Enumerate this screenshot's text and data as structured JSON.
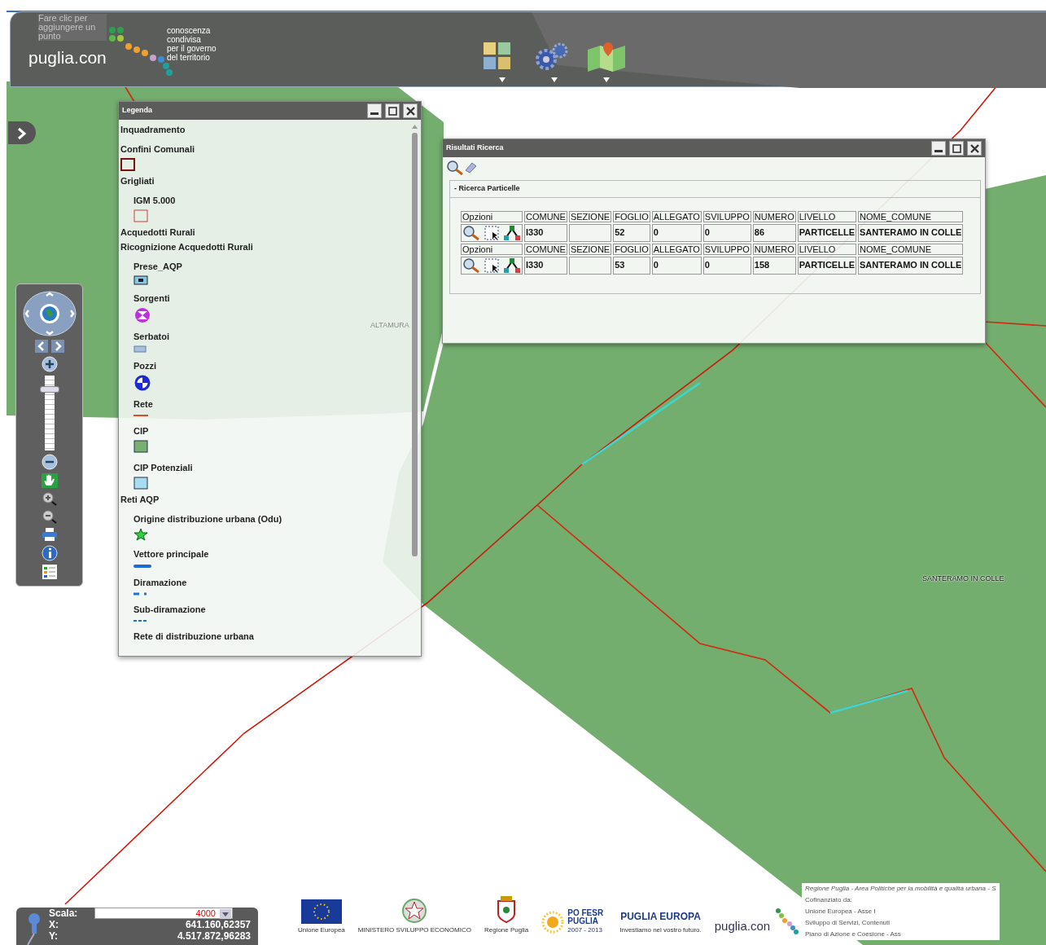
{
  "header": {
    "hint": "Fare clic per aggiungere un punto",
    "logo": "puglia.con",
    "tagline": "conoscenza\ncondivisa\nper il governo\ndel territorio",
    "tools": [
      {
        "kind": "layers"
      },
      {
        "kind": "settings"
      },
      {
        "kind": "map"
      }
    ]
  },
  "map": {
    "labels": [
      {
        "kind": "faint",
        "text": "ALTAMURA"
      },
      {
        "kind": "dark",
        "text": "SANTERAMO IN COLLE"
      }
    ]
  },
  "legend": {
    "title": "Legenda",
    "entries": [
      {
        "label": "Inquadramento"
      },
      {
        "label": "Confini Comunali",
        "kind": "outline-dark"
      },
      {
        "label": "Grigliati",
        "children": [
          {
            "label": "IGM 5.000",
            "kind": "outline-red"
          }
        ]
      },
      {
        "label": "Acquedotti Rurali"
      },
      {
        "label": "Ricognizione Acquedotti Rurali",
        "children": [
          {
            "label": "Prese_AQP",
            "kind": "tap"
          },
          {
            "label": "Sorgenti",
            "kind": "source"
          },
          {
            "label": "Serbatoi",
            "kind": "tank"
          },
          {
            "label": "Pozzi",
            "kind": "well"
          },
          {
            "label": "Rete",
            "kind": "line-red"
          },
          {
            "label": "CIP",
            "kind": "fill-green"
          },
          {
            "label": "CIP Potenziali",
            "kind": "fill-blue"
          }
        ]
      },
      {
        "label": "Reti AQP",
        "children": [
          {
            "label": "Origine distribuzione urbana (Odu)",
            "kind": "star"
          },
          {
            "label": "Vettore principale",
            "kind": "line-thick"
          },
          {
            "label": "Diramazione",
            "kind": "line-dash"
          },
          {
            "label": "Sub-diramazione",
            "kind": "line-dotted"
          },
          {
            "label": "Rete di distribuzione urbana"
          }
        ]
      }
    ]
  },
  "results": {
    "title": "Risultati Ricerca",
    "section": "- Ricerca Particelle",
    "records": [
      {
        "columns": [
          "Opzioni",
          "COMUNE",
          "SEZIONE",
          "FOGLIO",
          "ALLEGATO",
          "SVILUPPO",
          "NUMERO",
          "LIVELLO",
          "NOME_COMUNE"
        ],
        "values": {
          "comune": "I330",
          "foglio": "52",
          "allegato": "0",
          "sviluppo": "0",
          "numero": "86",
          "livello": "PARTICELLE",
          "nome_comune": "SANTERAMO IN COLLE"
        }
      },
      {
        "columns": [
          "Opzioni",
          "COMUNE",
          "SEZIONE",
          "FOGLIO",
          "ALLEGATO",
          "SVILUPPO",
          "NUMERO",
          "LIVELLO",
          "NOME_COMUNE"
        ],
        "values": {
          "comune": "I330",
          "foglio": "53",
          "allegato": "0",
          "sviluppo": "0",
          "numero": "158",
          "livello": "PARTICELLE",
          "nome_comune": "SANTERAMO IN COLLE"
        }
      }
    ]
  },
  "navigation": {
    "zoom": {
      "level": 0.85
    }
  },
  "scale_panel": {
    "scale_label": "Scala:",
    "scale_value": "4000",
    "x_label": "X:",
    "x_value": "641.160,62357",
    "y_label": "Y:",
    "y_value": "4.517.872,96283"
  },
  "footer": {
    "logos": [
      {
        "kind": "eu",
        "caption": "Unione Europea"
      },
      {
        "kind": "ministry",
        "caption": "MINISTERO SVILUPPO ECONOMICO"
      },
      {
        "kind": "region",
        "caption": "Regione Puglia"
      },
      {
        "kind": "fesr",
        "title": "PO FESR PUGLIA",
        "caption": "2007 - 2013"
      },
      {
        "kind": "europa",
        "title": "PUGLIA EUROPA",
        "caption": "Investiamo nel vostro futuro."
      },
      {
        "kind": "pugliacon",
        "title": "puglia.con"
      }
    ],
    "credits": [
      "Regione Puglia - Area Politiche per la mobilità e qualità urbana - S",
      "Cofinanziato da:",
      "Unione Europea - Asse I",
      "Sviluppo di Servizi, Contenuti",
      "Piano di Azione e Coesione - Ass"
    ]
  }
}
